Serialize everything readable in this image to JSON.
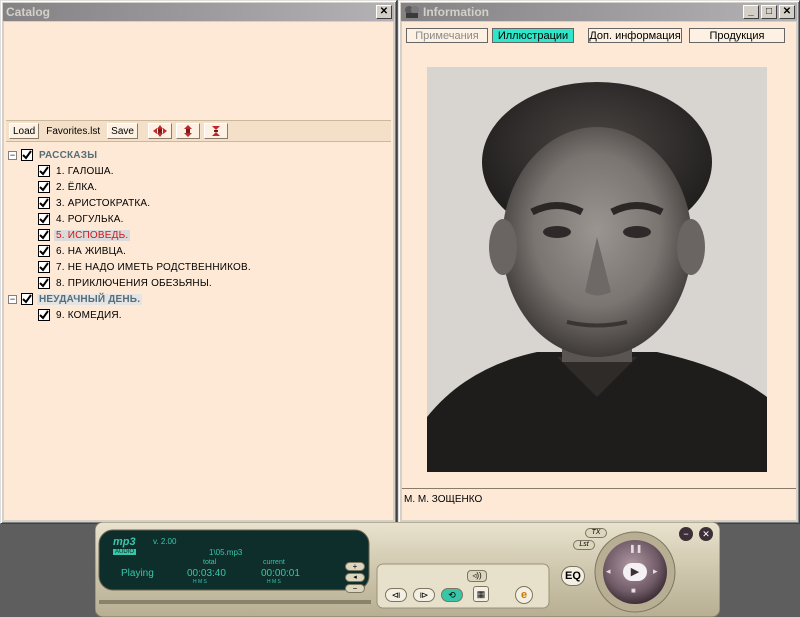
{
  "catalog": {
    "title": "Catalog",
    "toolbar": {
      "load": "Load",
      "list_name": "Favorites.lst",
      "save": "Save"
    },
    "groups": [
      {
        "label": "РАССКАЗЫ",
        "items": [
          "1. ГАЛОША.",
          "2. ЁЛКА.",
          "3. АРИСТОКРАТКА.",
          "4. РОГУЛЬКА.",
          "5. ИСПОВЕДЬ.",
          "6. НА ЖИВЦА.",
          "7. НЕ НАДО ИМЕТЬ РОДСТВЕННИКОВ.",
          "8. ПРИКЛЮЧЕНИЯ ОБЕЗЬЯНЫ."
        ]
      },
      {
        "label": "НЕУДАЧНЫЙ ДЕНЬ.",
        "items": [
          "9. КОМЕДИЯ."
        ]
      }
    ],
    "active_item": "5. ИСПОВЕДЬ."
  },
  "info": {
    "title": "Information",
    "tabs": [
      "Примечания",
      "Иллюстрации",
      "Доп. информация",
      "Продукция"
    ],
    "selected_tab": "Иллюстрации",
    "caption": "М. М. ЗОЩЕНКО"
  },
  "player": {
    "logo": "mp3",
    "logo_sub": "AUDIO",
    "version": "v. 2.00",
    "file": "1\\05.mp3",
    "total_label": "total",
    "current_label": "current",
    "hms": "H  M  S",
    "status": "Playing",
    "total_time": "00:03:40",
    "current_time": "00:00:01",
    "eq_label": "EQ",
    "tx_label": "TX",
    "lst_label": "Lst"
  },
  "colors": {
    "panel_bg": "#fde9d6",
    "selected_tab": "#2fe6c8",
    "active_item": "#dd1111",
    "group_label": "#556e7a",
    "lcd_bg": "#0e2e2c",
    "lcd_text": "#38c6a8"
  }
}
